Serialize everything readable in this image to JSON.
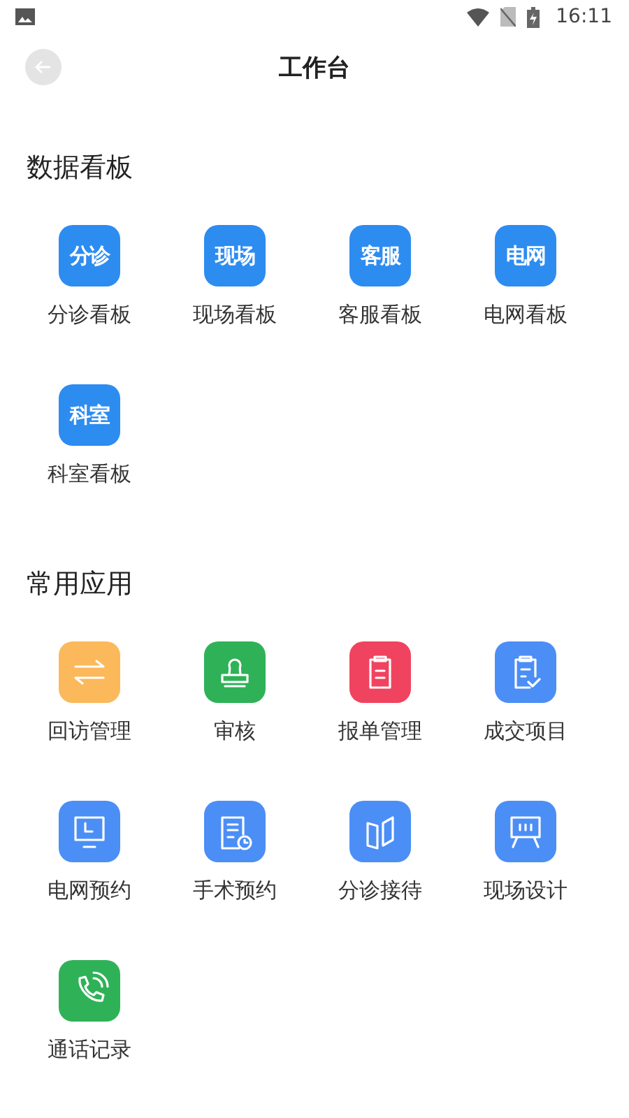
{
  "status_bar": {
    "time": "16:11"
  },
  "header": {
    "title": "工作台"
  },
  "sections": [
    {
      "title": "数据看板",
      "items": [
        {
          "label": "分诊看板",
          "kind": "text",
          "icon_text": "分诊",
          "color": "#2d8cf0"
        },
        {
          "label": "现场看板",
          "kind": "text",
          "icon_text": "现场",
          "color": "#2d8cf0"
        },
        {
          "label": "客服看板",
          "kind": "text",
          "icon_text": "客服",
          "color": "#2d8cf0"
        },
        {
          "label": "电网看板",
          "kind": "text",
          "icon_text": "电网",
          "color": "#2d8cf0"
        },
        {
          "label": "科室看板",
          "kind": "text",
          "icon_text": "科室",
          "color": "#2d8cf0"
        }
      ]
    },
    {
      "title": "常用应用",
      "items": [
        {
          "label": "回访管理",
          "kind": "swap",
          "color": "#fbb95c"
        },
        {
          "label": "审核",
          "kind": "stamp",
          "color": "#2fb257"
        },
        {
          "label": "报单管理",
          "kind": "clipboard",
          "color": "#f0435f"
        },
        {
          "label": "成交项目",
          "kind": "check",
          "color": "#4b8ef6"
        },
        {
          "label": "电网预约",
          "kind": "monitor",
          "color": "#4b8ef6"
        },
        {
          "label": "手术预约",
          "kind": "clockdoc",
          "color": "#4b8ef6"
        },
        {
          "label": "分诊接待",
          "kind": "panels",
          "color": "#4b8ef6"
        },
        {
          "label": "现场设计",
          "kind": "easel",
          "color": "#4b8ef6"
        },
        {
          "label": "通话记录",
          "kind": "phone",
          "color": "#2fb257"
        }
      ]
    }
  ]
}
